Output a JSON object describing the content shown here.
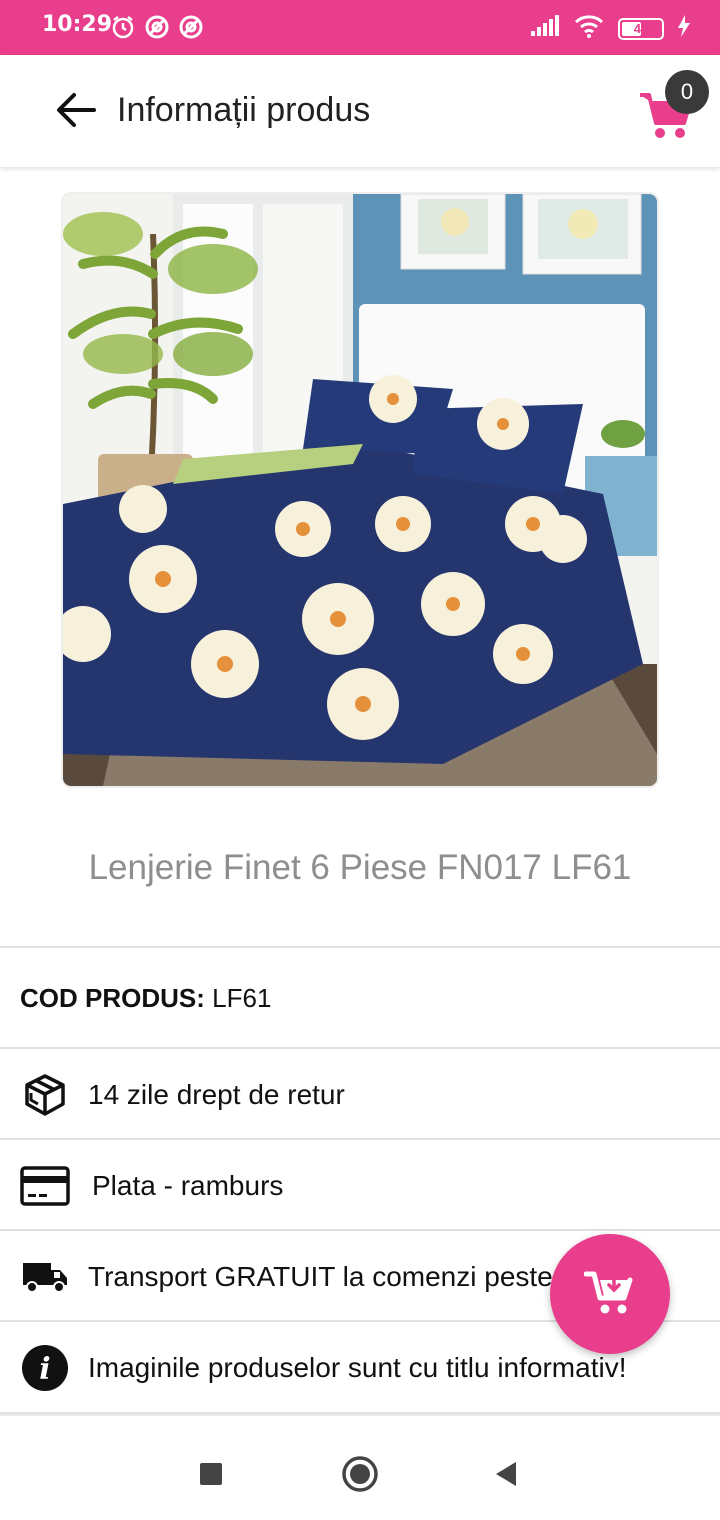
{
  "status_bar": {
    "time": "10:29",
    "battery_percent": "49",
    "icons": [
      "alarm-icon",
      "do-not-disturb-icon",
      "do-not-disturb-icon",
      "signal-icon",
      "wifi-icon",
      "battery-icon",
      "charging-icon"
    ]
  },
  "app_bar": {
    "title": "Informații produs",
    "cart_count": "0",
    "accent_color": "#e83e8c"
  },
  "product": {
    "image_alt": "product-photo",
    "name": "Lenjerie Finet 6 Piese FN017 LF61",
    "code_label": "COD PRODUS:",
    "code_value": "LF61"
  },
  "info_rows": [
    {
      "icon": "package-return-icon",
      "text": "14 zile drept de retur"
    },
    {
      "icon": "credit-card-icon",
      "text": "Plata - ramburs"
    },
    {
      "icon": "truck-icon",
      "text": "Transport GRATUIT la comenzi peste 250 lei"
    },
    {
      "icon": "info-icon",
      "text": "Imaginile produselor sunt cu titlu informativ!"
    }
  ],
  "fab": {
    "icon": "add-to-cart-icon"
  },
  "nav_bar": {
    "icons": [
      "recent-apps-icon",
      "home-icon",
      "back-icon"
    ]
  }
}
